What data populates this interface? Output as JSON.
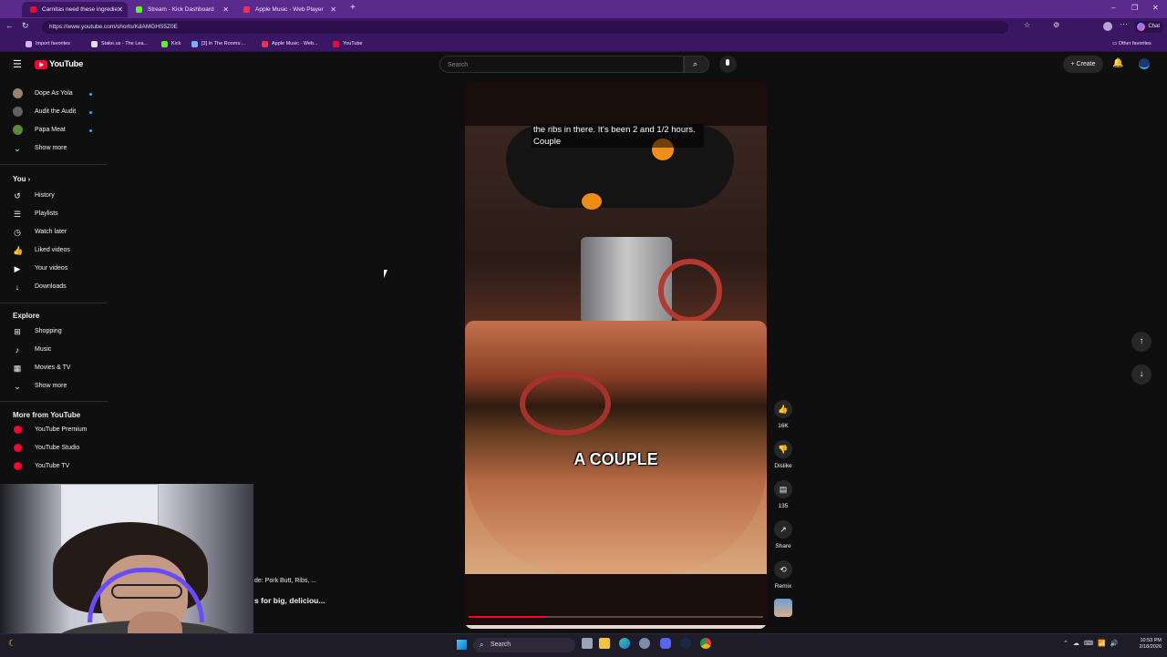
{
  "browser": {
    "tabs": [
      {
        "title": "Carnitas need these ingredie",
        "active": true,
        "favicon_color": "#ff0033"
      },
      {
        "title": "Stream - Kick Dashboard",
        "active": false,
        "favicon_color": "#53fc18"
      },
      {
        "title": "Apple Music - Web Player",
        "active": false,
        "favicon_color": "#fa2d48"
      }
    ],
    "new_tab": "+",
    "url": "https://www.youtube.com/shorts/KdAMGHS5Z0E",
    "bookmarks": [
      {
        "label": "Import favorites",
        "color": "#c9b8ff"
      },
      {
        "label": "Stake.us - The Lea...",
        "color": "#e0e0e0"
      },
      {
        "label": "Kick",
        "color": "#53fc18"
      },
      {
        "label": "[3] In The Rooms:...",
        "color": "#7ab0ff"
      },
      {
        "label": "Apple Music - Web...",
        "color": "#fa2d48"
      },
      {
        "label": "YouTube",
        "color": "#ff0033"
      }
    ],
    "other_favorites": "Other favorites",
    "chat_label": "Chat"
  },
  "youtube": {
    "logo_text": "YouTube",
    "search_placeholder": "Search",
    "create_label": "Create",
    "subscriptions": [
      {
        "label": "Dope As Yola",
        "avatar_color": "#9a8070"
      },
      {
        "label": "Audit the Audit",
        "avatar_color": "#606060"
      },
      {
        "label": "Papa Meat",
        "avatar_color": "#5a8a3a"
      }
    ],
    "show_more_1": "Show more",
    "you_heading": "You",
    "you_items": [
      {
        "label": "History",
        "icon": "history-icon",
        "glyph": "↺"
      },
      {
        "label": "Playlists",
        "icon": "playlists-icon",
        "glyph": "☰"
      },
      {
        "label": "Watch later",
        "icon": "clock-icon",
        "glyph": "◷"
      },
      {
        "label": "Liked videos",
        "icon": "thumb-up-icon",
        "glyph": "👍"
      },
      {
        "label": "Your videos",
        "icon": "video-icon",
        "glyph": "▶"
      },
      {
        "label": "Downloads",
        "icon": "download-icon",
        "glyph": "↓"
      }
    ],
    "explore_heading": "Explore",
    "explore_items": [
      {
        "label": "Shopping",
        "icon": "shopping-bag-icon",
        "glyph": "⊞"
      },
      {
        "label": "Music",
        "icon": "music-icon",
        "glyph": "♪"
      },
      {
        "label": "Movies & TV",
        "icon": "film-icon",
        "glyph": "▦"
      }
    ],
    "show_more_2": "Show more",
    "more_heading": "More from YouTube",
    "more_items": [
      {
        "label": "YouTube Premium"
      },
      {
        "label": "YouTube Studio"
      },
      {
        "label": "YouTube TV"
      }
    ],
    "video": {
      "caption_top": "the ribs in there. It's been 2 and 1/2 hours. Couple",
      "caption_big": "A COUPLE"
    },
    "actions": {
      "likes": "16K",
      "dislike": "Dislike",
      "comments": "135",
      "share": "Share",
      "remix": "Remix"
    },
    "below_video": {
      "line1": "de: Pork Butt, Ribs, ...",
      "line2": "s for big, deliciou..."
    }
  },
  "taskbar": {
    "search_label": "Search",
    "time": "10:53 PM",
    "date": "2/18/2026"
  }
}
